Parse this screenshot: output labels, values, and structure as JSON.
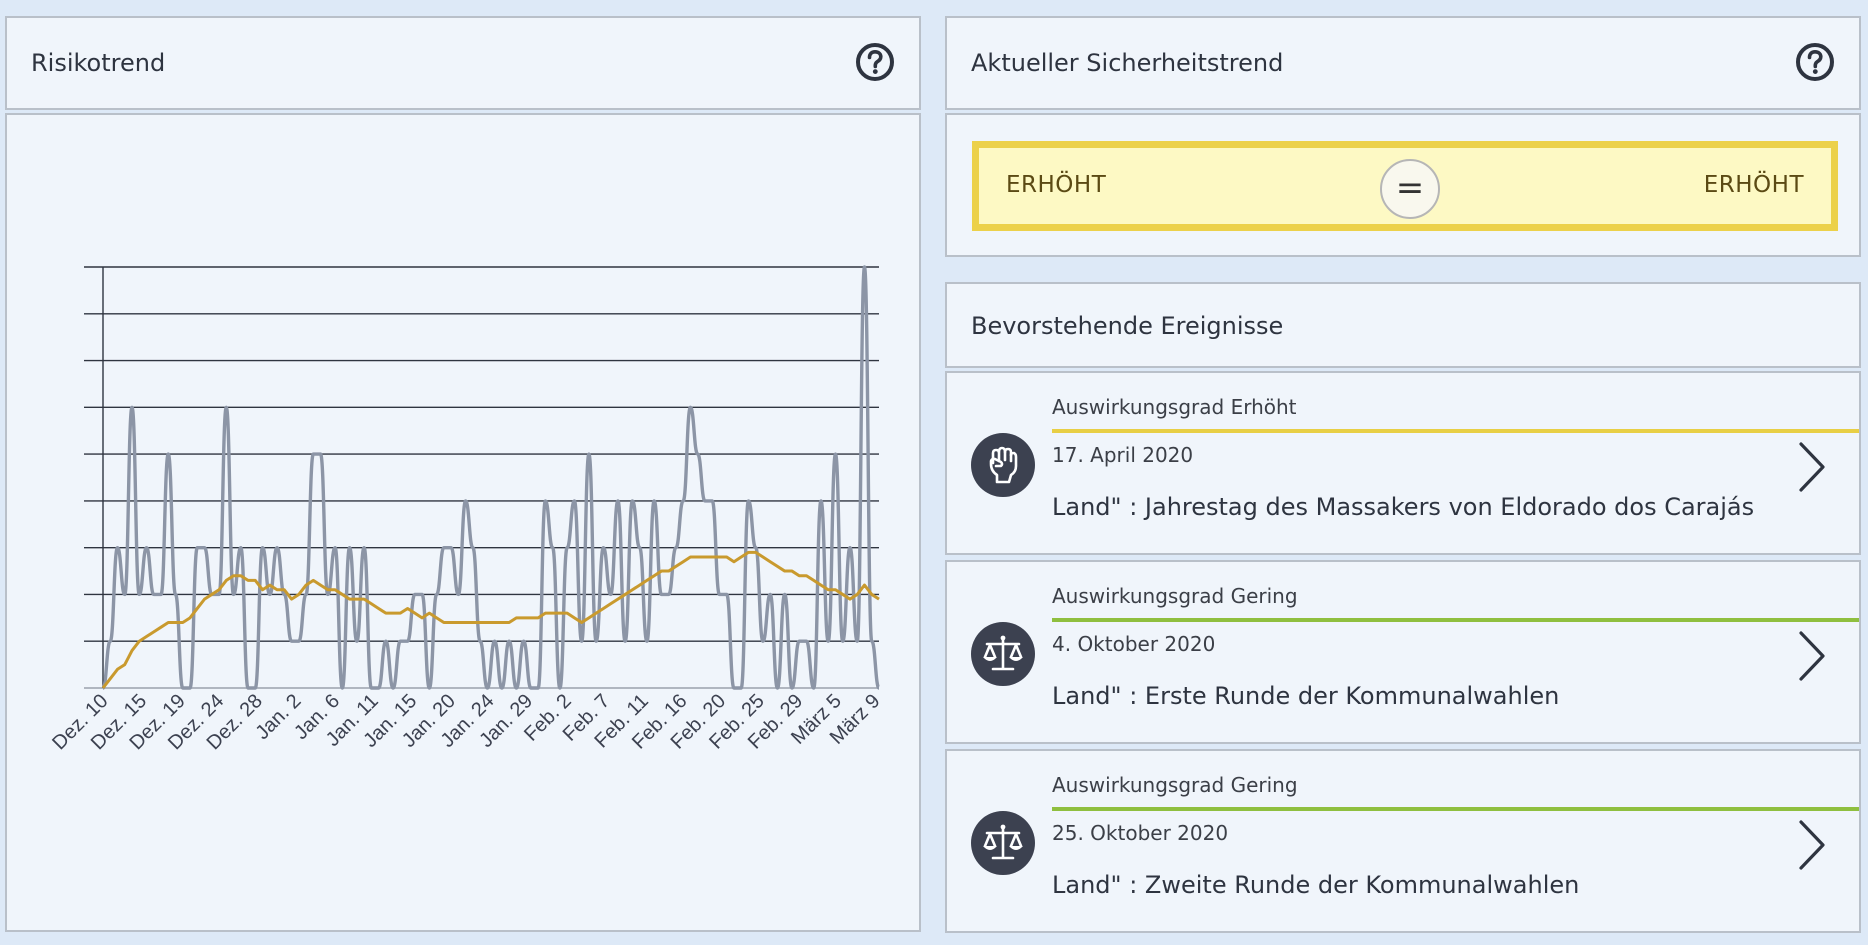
{
  "risk_panel": {
    "title": "Risikotrend",
    "help_icon": "question-circle-icon"
  },
  "trend_panel": {
    "title": "Aktueller Sicherheitstrend",
    "help_icon": "question-circle-icon",
    "previous_level": "ERHÖHT",
    "current_level": "ERHÖHT",
    "change_symbol": "=",
    "level_color": "#ecd14a"
  },
  "events_panel": {
    "title": "Bevorstehende Ereignisse",
    "items": [
      {
        "impact": "Auswirkungsgrad Erhöht",
        "impact_color": "#e8cf45",
        "date": "17. April 2020",
        "title": "Land\" : Jahrestag des Massakers von Eldorado dos Carajás",
        "icon": "raised-fist-icon"
      },
      {
        "impact": "Auswirkungsgrad Gering",
        "impact_color": "#8fbf3f",
        "date": "4. Oktober 2020",
        "title": "Land\" : Erste Runde der Kommunalwahlen",
        "icon": "balance-scale-icon"
      },
      {
        "impact": "Auswirkungsgrad Gering",
        "impact_color": "#8fbf3f",
        "date": "25. Oktober 2020",
        "title": "Land\" : Zweite Runde der Kommunalwahlen",
        "icon": "balance-scale-icon"
      }
    ]
  },
  "chart_data": {
    "type": "line",
    "title": "",
    "xlabel": "",
    "ylabel": "",
    "ylim": [
      0,
      9
    ],
    "grid": true,
    "x_tick_labels": [
      "Dez. 10",
      "Dez. 15",
      "Dez. 19",
      "Dez. 24",
      "Dez. 28",
      "Jan. 2",
      "Jan. 6",
      "Jan. 11",
      "Jan. 15",
      "Jan. 20",
      "Jan. 24",
      "Jan. 29",
      "Feb. 2",
      "Feb. 7",
      "Feb. 11",
      "Feb. 16",
      "Feb. 20",
      "Feb. 25",
      "Feb. 29",
      "März 5",
      "März 9"
    ],
    "series": [
      {
        "color": "#8c95a6",
        "values": [
          0,
          1,
          3,
          2,
          6,
          2,
          3,
          2,
          2,
          5,
          2,
          0,
          0,
          3,
          3,
          2,
          2,
          6,
          2,
          3,
          0,
          0,
          3,
          2,
          3,
          2,
          1,
          1,
          2,
          5,
          5,
          2,
          3,
          0,
          3,
          1,
          3,
          0,
          0,
          1,
          0,
          1,
          1,
          2,
          2,
          0,
          2,
          3,
          3,
          2,
          4,
          3,
          1,
          0,
          1,
          0,
          1,
          0,
          1,
          0,
          0,
          4,
          3,
          0,
          3,
          4,
          1,
          5,
          1,
          3,
          2,
          4,
          1,
          4,
          3,
          1,
          4,
          2,
          2,
          3,
          4,
          6,
          5,
          4,
          4,
          2,
          2,
          0,
          0,
          4,
          3,
          1,
          2,
          0,
          2,
          0,
          1,
          1,
          0,
          4,
          1,
          5,
          1,
          3,
          1,
          9,
          1,
          0
        ]
      },
      {
        "color": "#c99a2e",
        "values": [
          0,
          0.2,
          0.4,
          0.5,
          0.8,
          1.0,
          1.1,
          1.2,
          1.3,
          1.4,
          1.4,
          1.4,
          1.5,
          1.7,
          1.9,
          2.0,
          2.1,
          2.3,
          2.4,
          2.4,
          2.3,
          2.3,
          2.1,
          2.2,
          2.1,
          2.1,
          1.9,
          2.0,
          2.2,
          2.3,
          2.2,
          2.1,
          2.1,
          2.0,
          1.9,
          1.9,
          1.9,
          1.8,
          1.7,
          1.6,
          1.6,
          1.6,
          1.7,
          1.6,
          1.5,
          1.6,
          1.5,
          1.4,
          1.4,
          1.4,
          1.4,
          1.4,
          1.4,
          1.4,
          1.4,
          1.4,
          1.4,
          1.5,
          1.5,
          1.5,
          1.5,
          1.6,
          1.6,
          1.6,
          1.6,
          1.5,
          1.4,
          1.5,
          1.6,
          1.7,
          1.8,
          1.9,
          2.0,
          2.1,
          2.2,
          2.3,
          2.4,
          2.5,
          2.5,
          2.6,
          2.7,
          2.8,
          2.8,
          2.8,
          2.8,
          2.8,
          2.8,
          2.7,
          2.8,
          2.9,
          2.9,
          2.8,
          2.7,
          2.6,
          2.5,
          2.5,
          2.4,
          2.4,
          2.3,
          2.2,
          2.1,
          2.1,
          2.0,
          1.9,
          2.0,
          2.2,
          2.0,
          1.9
        ]
      }
    ]
  }
}
